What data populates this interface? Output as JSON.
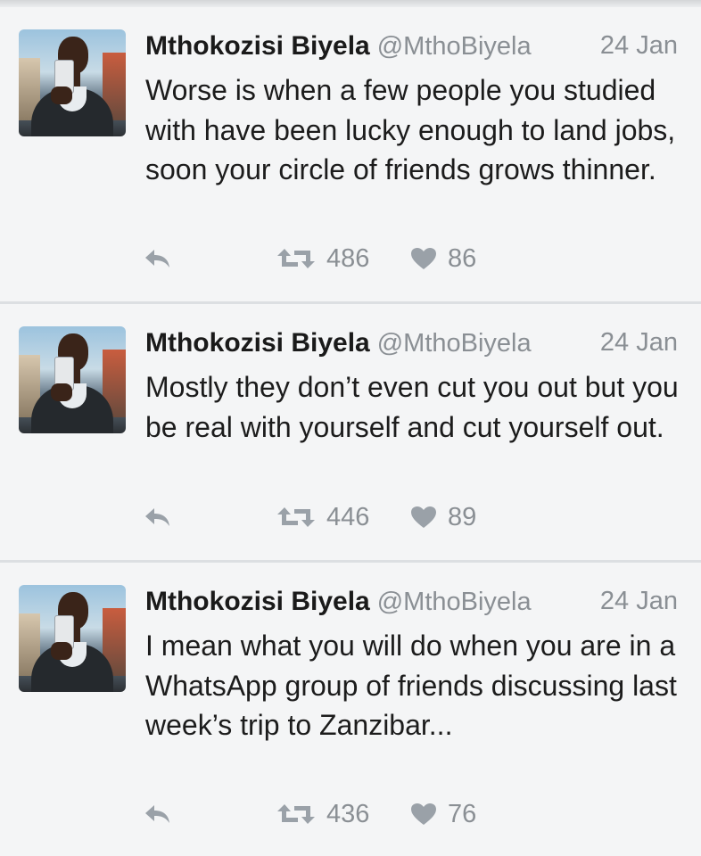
{
  "tweets": [
    {
      "author_name": "Mthokozisi Biyela",
      "handle": "@MthoBiyela",
      "date": "24 Jan",
      "text": "Worse is when a few people you studied with have been lucky enough to land jobs, soon your circle of friends grows thinner.",
      "retweets": "486",
      "likes": "86"
    },
    {
      "author_name": "Mthokozisi Biyela",
      "handle": "@MthoBiyela",
      "date": "24 Jan",
      "text": "Mostly they don’t even cut you out but you be real with yourself and cut yourself out.",
      "retweets": "446",
      "likes": "89"
    },
    {
      "author_name": "Mthokozisi Biyela",
      "handle": "@MthoBiyela",
      "date": "24 Jan",
      "text": "I mean what you will do when you are in a WhatsApp group of friends discussing last week’s trip to Zanzibar...",
      "retweets": "436",
      "likes": "76"
    }
  ],
  "icons": {
    "reply": "reply-icon",
    "retweet": "retweet-icon",
    "like": "heart-icon"
  },
  "colors": {
    "background": "#f4f5f6",
    "divider": "#dcdfe2",
    "muted_text": "#8a8f94",
    "body_text": "#1c1c1c",
    "icon": "#9aa1a8"
  }
}
